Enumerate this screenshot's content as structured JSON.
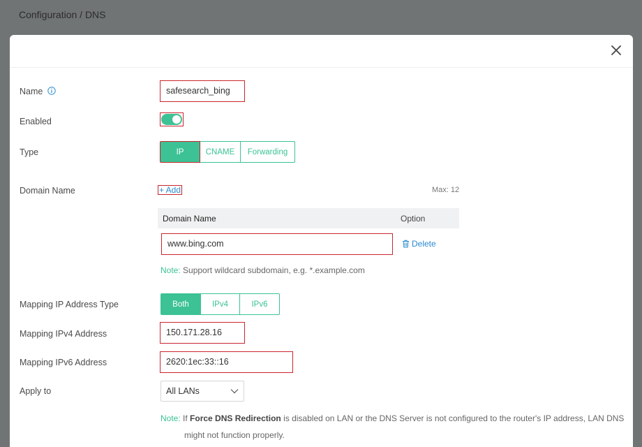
{
  "breadcrumb": "Configuration / DNS",
  "form": {
    "name_label": "Name",
    "name_value": "safesearch_bing",
    "enabled_label": "Enabled",
    "enabled": true,
    "type_label": "Type",
    "type_options": [
      "IP",
      "CNAME",
      "Forwarding"
    ],
    "type_selected": "IP",
    "domain_label": "Domain Name",
    "add_label": "+ Add",
    "max_label": "Max: 12",
    "table_headers": [
      "Domain Name",
      "Option"
    ],
    "domain_value": "www.bing.com",
    "delete_label": "Delete",
    "note_key": "Note:",
    "domain_note": "Support wildcard subdomain, e.g. *.example.com",
    "mapping_type_label": "Mapping IP Address Type",
    "mapping_options": [
      "Both",
      "IPv4",
      "IPv6"
    ],
    "mapping_selected": "Both",
    "ipv4_label": "Mapping IPv4 Address",
    "ipv4_value": "150.171.28.16",
    "ipv6_label": "Mapping IPv6 Address",
    "ipv6_value": "2620:1ec:33::16",
    "apply_label": "Apply to",
    "apply_value": "All LANs",
    "note2_pre": "If",
    "note2_bold": "Force DNS Redirection",
    "note2_line1": "is disabled on LAN or the DNS Server is not configured to the router's IP address, LAN DNS",
    "note2_line2": "might not function properly."
  },
  "colors": {
    "accent": "#3cc295",
    "link": "#2a8ad1",
    "highlight": "#c9252e",
    "overlay": "#717475"
  },
  "icons": {
    "close": "close-icon",
    "info": "info-icon",
    "trash": "trash-icon",
    "chevron": "chevron-down-icon"
  }
}
